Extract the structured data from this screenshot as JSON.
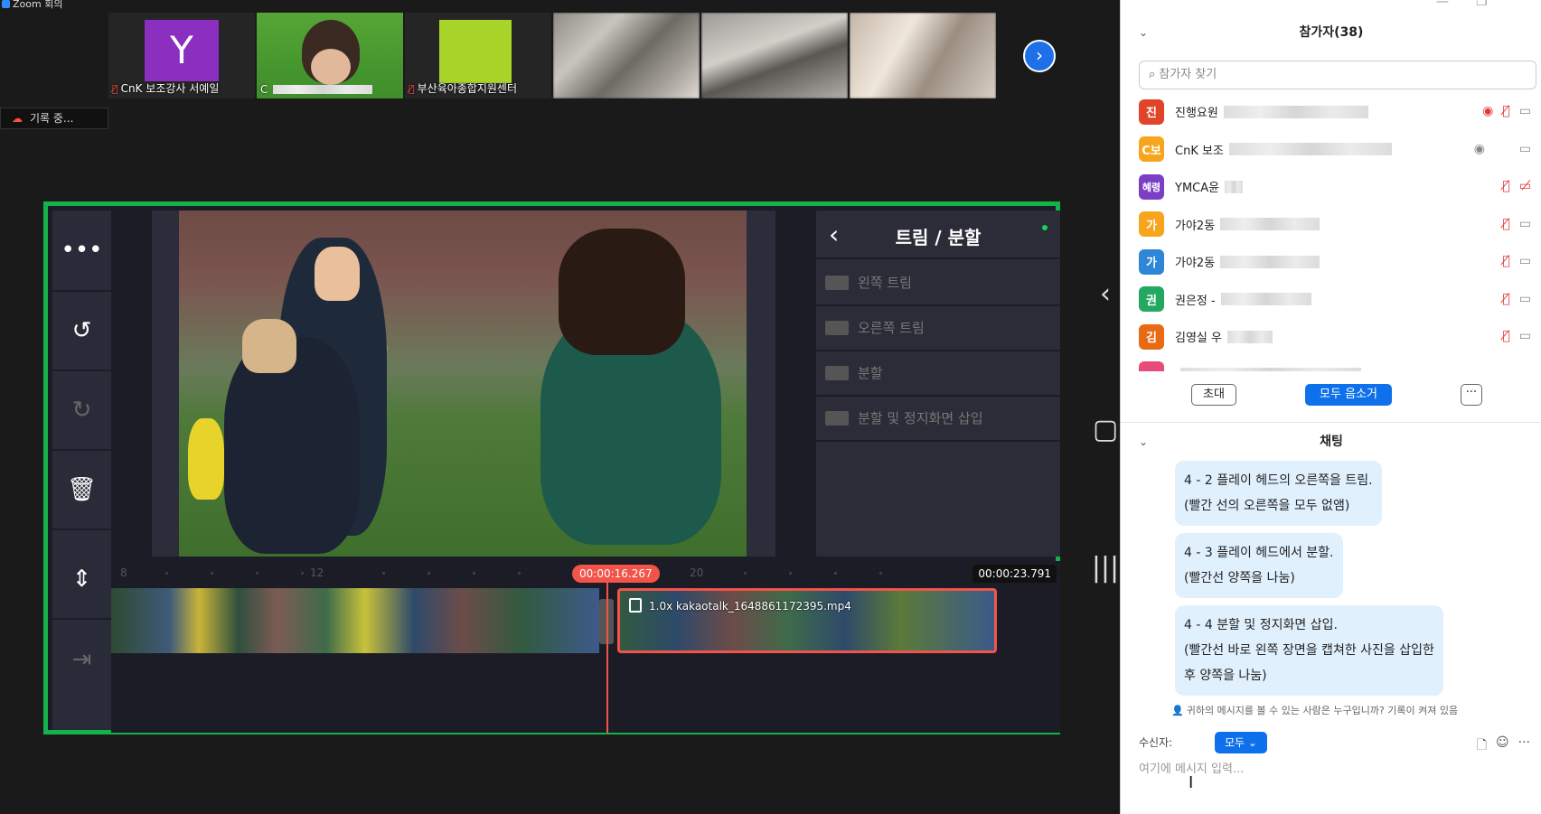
{
  "window": {
    "title": "Zoom 회의"
  },
  "thumbnails": [
    {
      "label": "CnK 보조강사 서예일",
      "avatar": "Y",
      "mic_muted": true
    },
    {
      "label": "C",
      "mic_muted": false,
      "active": true
    },
    {
      "label": "부산육아종합지원센터",
      "mic_muted": true
    }
  ],
  "recording": {
    "label": "기록 중..."
  },
  "editor": {
    "panel_title": "트림 / 분할",
    "menu": [
      "왼쪽 트림",
      "오른쪽 트림",
      "분할",
      "분할 및 정지화면 삽입"
    ],
    "playhead_time": "00:00:16.267",
    "end_time": "00:00:23.791",
    "ruler": [
      "8",
      "12",
      "20"
    ],
    "clip_name": "1.0x kakaotalk_1648861172395.mp4",
    "tools": [
      "more-icon",
      "undo-icon",
      "redo-icon",
      "delete-icon",
      "split-layout-icon",
      "insert-icon"
    ],
    "nav": [
      "back-icon",
      "home-icon",
      "recents-icon"
    ]
  },
  "participants": {
    "header": "참가자(38)",
    "search_placeholder": "참가자 찾기",
    "list": [
      {
        "avatar": "진",
        "color": "#e0452b",
        "name": "진행요원",
        "mic_muted": true,
        "video_off": false,
        "recording": true
      },
      {
        "avatar": "C보",
        "color": "#f7a51c",
        "name": "CnK 보조",
        "mic_muted": false,
        "video_off": false,
        "recording": true
      },
      {
        "avatar": "혜령",
        "color": "#7b3fc4",
        "name": "YMCA윤",
        "mic_muted": true,
        "video_off": true,
        "recording": false
      },
      {
        "avatar": "가",
        "color": "#f7a51c",
        "name": "가야2동",
        "mic_muted": true,
        "video_off": false,
        "recording": false
      },
      {
        "avatar": "가",
        "color": "#2d86d6",
        "name": "가야2동",
        "mic_muted": true,
        "video_off": false,
        "recording": false
      },
      {
        "avatar": "권",
        "color": "#22a861",
        "name": "권은정 -",
        "mic_muted": true,
        "video_off": false,
        "recording": false
      },
      {
        "avatar": "김",
        "color": "#e86a12",
        "name": "김영실 우",
        "mic_muted": true,
        "video_off": false,
        "recording": false
      }
    ],
    "invite_label": "초대",
    "mute_all_label": "모두 음소거",
    "more_label": "···"
  },
  "chat": {
    "header": "채팅",
    "messages": [
      {
        "line1": "4 - 2 플레이 헤드의 오른쪽을 트림.",
        "line2": "(빨간 선의 오른쪽을 모두 없앰)"
      },
      {
        "line1": "4 - 3 플레이 헤드에서 분할.",
        "line2": "(빨간선 양쪽을 나눔)"
      },
      {
        "line1": "4 - 4 분할 및 정지화면 삽입.",
        "line2": "(빨간선 바로 왼쪽 장면을 캡쳐한 사진을 삽입한",
        "line3": "후 양쪽을 나눔)"
      }
    ],
    "who_can_see": "귀하의 메시지를 볼 수 있는 사람은 누구입니까? 기록이 켜져 있음",
    "to_label": "수신자:",
    "to_value": "모두",
    "input_placeholder": "여기에 메시지 입력..."
  }
}
